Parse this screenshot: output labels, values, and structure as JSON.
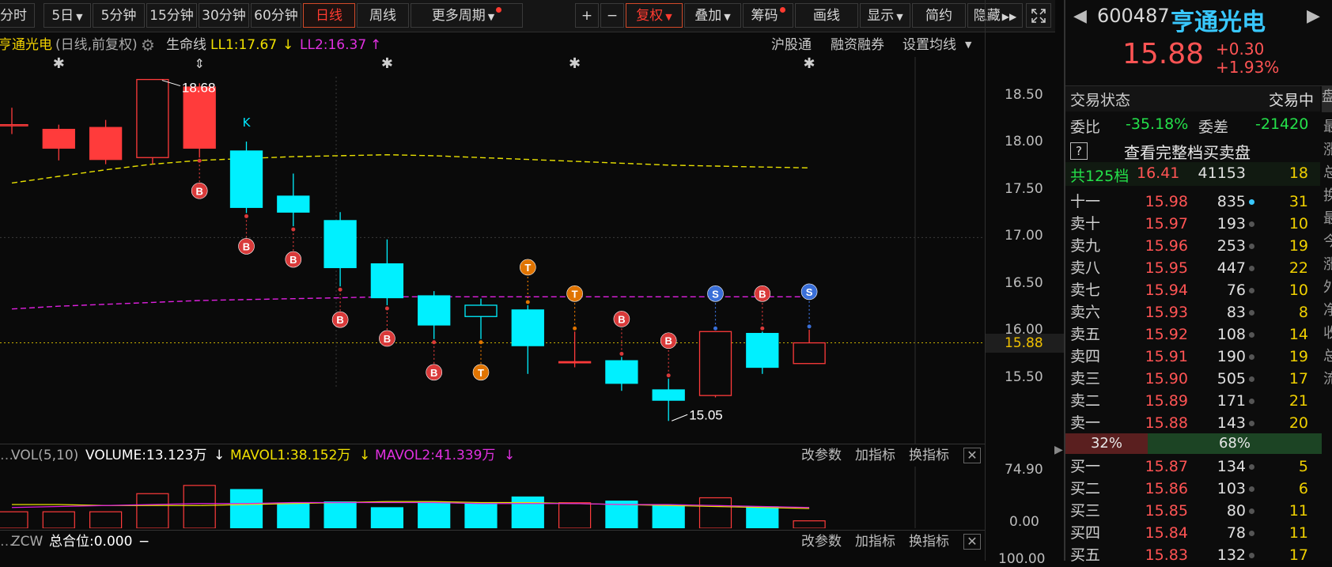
{
  "toolbar": {
    "tabs": [
      "分时",
      "5日",
      "5分钟",
      "15分钟",
      "30分钟",
      "60分钟",
      "日线",
      "周线",
      "更多周期"
    ],
    "active_tab": "日线",
    "tools": [
      "+",
      "−",
      "复权",
      "叠加",
      "筹码",
      "画线",
      "显示",
      "简约",
      "隐藏"
    ],
    "expand_icon": "expand-icon"
  },
  "chart_header": {
    "name": "亨通光电",
    "mode": "(日线,前复权)",
    "lifeline": "生命线",
    "ll1": "LL1:17.67",
    "ll2": "LL2:16.37",
    "links": [
      "沪股通",
      "融资融券",
      "设置均线"
    ]
  },
  "colors": {
    "up": "#ff3b3b",
    "down": "#00f0ff",
    "ma1": "#e8e000",
    "ma2": "#e020e0",
    "bg": "#0a0a0a",
    "grid": "#3a3a3a"
  },
  "chart_data": {
    "type": "candlestick",
    "yticks": [
      "18.50",
      "18.00",
      "17.50",
      "17.00",
      "16.50",
      "16.00",
      "15.50"
    ],
    "ytick_values": [
      18.5,
      18.0,
      17.5,
      17.0,
      16.5,
      16.0,
      15.5
    ],
    "current_price": 15.88,
    "high_label": "18.68",
    "low_label": "15.05",
    "k_marker": "K",
    "candles": [
      {
        "o": 18.2,
        "c": 18.2,
        "h": 18.38,
        "l": 18.1,
        "sig": ""
      },
      {
        "o": 17.95,
        "c": 18.15,
        "h": 18.2,
        "l": 17.82,
        "sig": ""
      },
      {
        "o": 17.83,
        "c": 18.17,
        "h": 18.25,
        "l": 17.78,
        "sig": ""
      },
      {
        "o": 17.85,
        "c": 18.68,
        "h": 18.68,
        "l": 17.78,
        "sig": ""
      },
      {
        "o": 17.95,
        "c": 18.6,
        "h": 18.64,
        "l": 17.85,
        "sig": "B"
      },
      {
        "o": 17.92,
        "c": 17.32,
        "h": 18.02,
        "l": 17.26,
        "sig": "B"
      },
      {
        "o": 17.44,
        "c": 17.27,
        "h": 17.68,
        "l": 17.12,
        "sig": "B"
      },
      {
        "o": 17.18,
        "c": 16.68,
        "h": 17.27,
        "l": 16.48,
        "sig": "B"
      },
      {
        "o": 16.72,
        "c": 16.36,
        "h": 16.98,
        "l": 16.28,
        "sig": "B"
      },
      {
        "o": 16.38,
        "c": 16.07,
        "h": 16.43,
        "l": 15.92,
        "sig": "B"
      },
      {
        "o": 16.28,
        "c": 16.16,
        "h": 16.35,
        "l": 15.92,
        "sig": "T"
      },
      {
        "o": 16.23,
        "c": 15.85,
        "h": 16.28,
        "l": 15.55,
        "sig": "T"
      },
      {
        "o": 15.68,
        "c": 15.68,
        "h": 16.0,
        "l": 15.62,
        "sig": "T"
      },
      {
        "o": 15.69,
        "c": 15.45,
        "h": 15.73,
        "l": 15.37,
        "sig": "B"
      },
      {
        "o": 15.38,
        "c": 15.27,
        "h": 15.5,
        "l": 15.05,
        "sig": "B"
      },
      {
        "o": 15.32,
        "c": 16.0,
        "h": 16.0,
        "l": 15.3,
        "sig": "S"
      },
      {
        "o": 15.98,
        "c": 15.62,
        "h": 16.0,
        "l": 15.55,
        "sig": "B"
      },
      {
        "o": 15.66,
        "c": 15.88,
        "h": 16.02,
        "l": 15.66,
        "sig": "S"
      }
    ],
    "top_asterisk_candles": [
      1,
      8,
      12,
      17
    ],
    "top_arrow_candle": 4,
    "ma1": [
      17.58,
      17.65,
      17.72,
      17.78,
      17.82,
      17.84,
      17.86,
      17.87,
      17.88,
      17.87,
      17.85,
      17.83,
      17.81,
      17.79,
      17.77,
      17.76,
      17.75,
      17.74
    ],
    "ma2": [
      16.24,
      16.27,
      16.29,
      16.31,
      16.33,
      16.34,
      16.35,
      16.36,
      16.37,
      16.37,
      16.37,
      16.37,
      16.37,
      16.37,
      16.37,
      16.37,
      16.37,
      16.37
    ]
  },
  "volume_panel": {
    "header": "VOL(5,10)",
    "volume": "VOLUME:13.123万",
    "mavol1": "MAVOL1:38.152万",
    "mavol2": "MAVOL2:41.339万",
    "yticks": [
      "74.90",
      "0.00"
    ],
    "buttons": [
      "改参数",
      "加指标",
      "换指标"
    ],
    "bars": [
      20,
      20,
      20,
      42,
      52,
      47,
      30,
      32,
      25,
      32,
      30,
      38,
      31,
      33,
      28,
      37,
      26,
      9
    ],
    "ymax": 74.9
  },
  "zcw_panel": {
    "header": "ZCW",
    "total": "总合位:0.000",
    "ytick": "100.00",
    "buttons": [
      "改参数",
      "加指标",
      "换指标"
    ]
  },
  "quote": {
    "code": "600487",
    "name": "亨通光电",
    "price": "15.88",
    "change": "+0.30",
    "pct": "+1.93%",
    "status_label": "交易状态",
    "status_value": "交易中",
    "wb_label": "委比",
    "wb_value": "-35.18%",
    "wc_label": "委差",
    "wc_value": "-21420",
    "full_book": "查看完整档买卖盘",
    "help": "?",
    "total_label": "共125档",
    "total_price": "16.41",
    "total_vol": "41153",
    "total_cnt": "18",
    "asks": [
      {
        "label": "十一",
        "price": "15.98",
        "vol": "835",
        "cnt": "31"
      },
      {
        "label": "卖十",
        "price": "15.97",
        "vol": "193",
        "cnt": "10"
      },
      {
        "label": "卖九",
        "price": "15.96",
        "vol": "253",
        "cnt": "19"
      },
      {
        "label": "卖八",
        "price": "15.95",
        "vol": "447",
        "cnt": "22"
      },
      {
        "label": "卖七",
        "price": "15.94",
        "vol": "76",
        "cnt": "10"
      },
      {
        "label": "卖六",
        "price": "15.93",
        "vol": "83",
        "cnt": "8"
      },
      {
        "label": "卖五",
        "price": "15.92",
        "vol": "108",
        "cnt": "14"
      },
      {
        "label": "卖四",
        "price": "15.91",
        "vol": "190",
        "cnt": "19"
      },
      {
        "label": "卖三",
        "price": "15.90",
        "vol": "505",
        "cnt": "17"
      },
      {
        "label": "卖二",
        "price": "15.89",
        "vol": "171",
        "cnt": "21"
      },
      {
        "label": "卖一",
        "price": "15.88",
        "vol": "143",
        "cnt": "20"
      }
    ],
    "sell_pct": "32%",
    "buy_pct": "68%",
    "sell_ratio": 0.32,
    "bids": [
      {
        "label": "买一",
        "price": "15.87",
        "vol": "134",
        "cnt": "5"
      },
      {
        "label": "买二",
        "price": "15.86",
        "vol": "103",
        "cnt": "6"
      },
      {
        "label": "买三",
        "price": "15.85",
        "vol": "80",
        "cnt": "11"
      },
      {
        "label": "买四",
        "price": "15.84",
        "vol": "78",
        "cnt": "11"
      },
      {
        "label": "买五",
        "price": "15.83",
        "vol": "132",
        "cnt": "17"
      }
    ],
    "side_tab": "盘",
    "side_chars": [
      "最",
      "涨",
      "总",
      "换",
      "最",
      "今",
      "涨",
      "外",
      "净",
      "收",
      "总",
      "流"
    ]
  }
}
